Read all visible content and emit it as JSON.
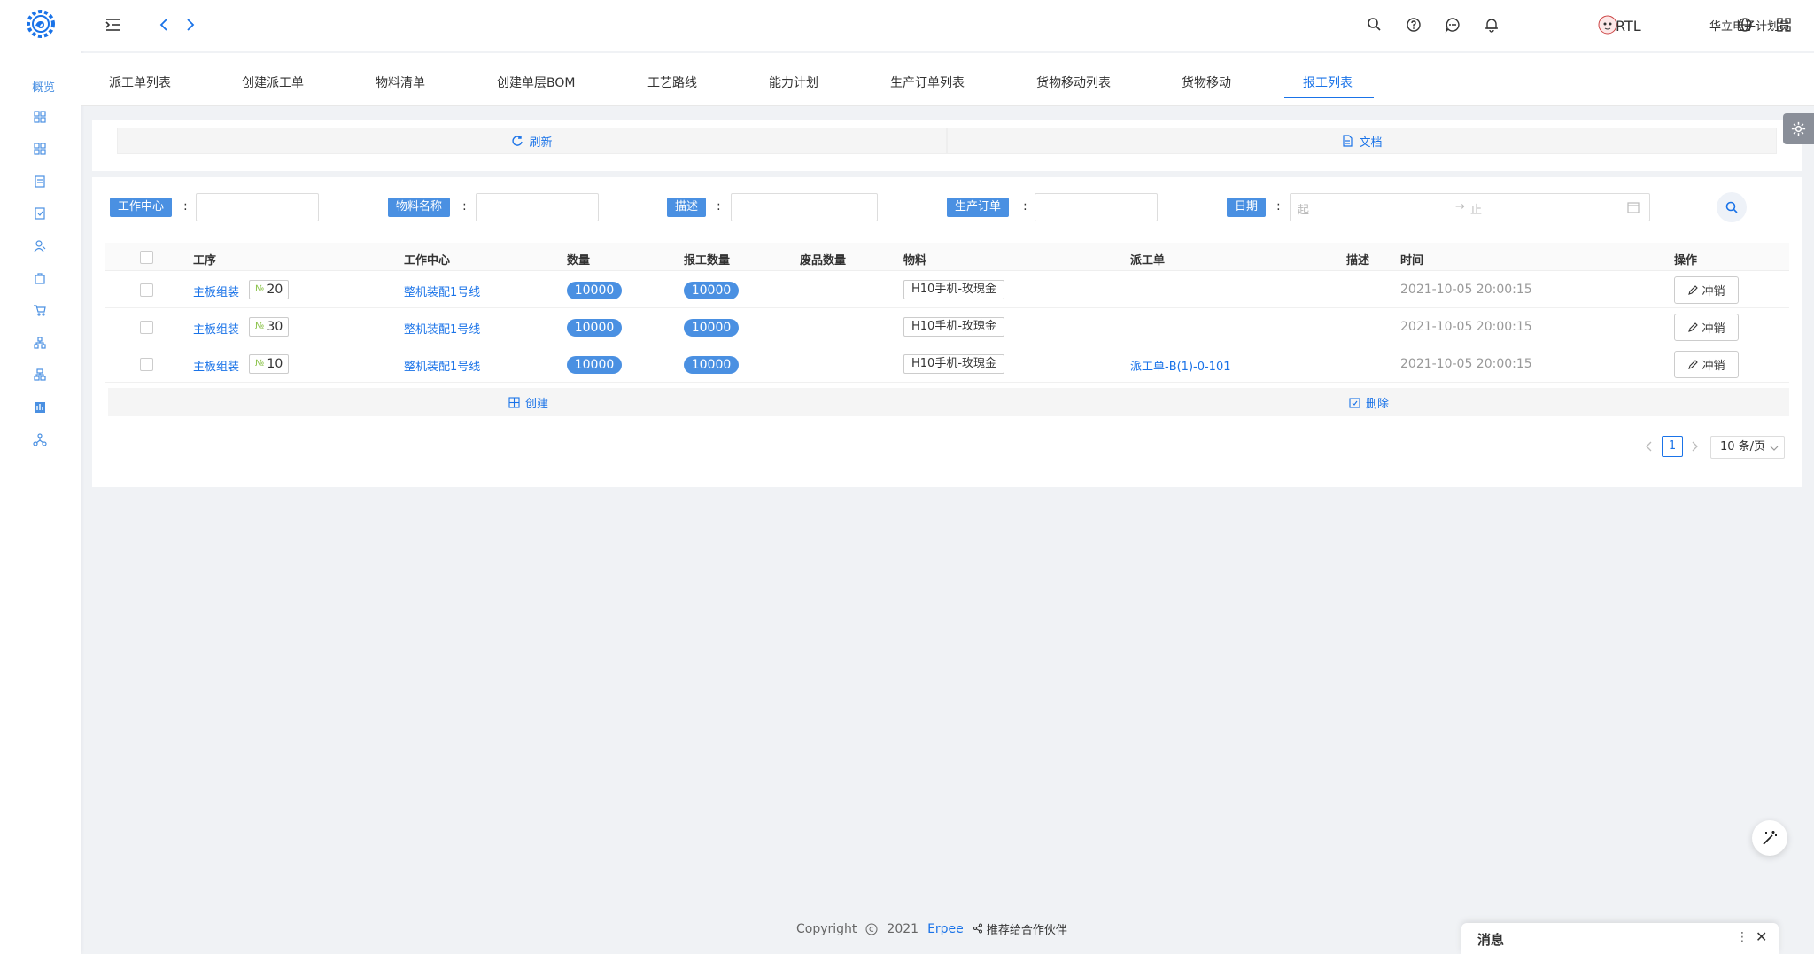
{
  "sidebar": {
    "label": "概览",
    "icons": [
      "grid-icon",
      "apps-icon",
      "document-icon",
      "shield-doc-icon",
      "users-icon",
      "bag-icon",
      "cart-icon",
      "org-chart-icon",
      "hierarchy-icon",
      "report-icon",
      "network-icon"
    ]
  },
  "header": {
    "rtl_label": "RTL",
    "user_name": "华立电子计划员"
  },
  "tabs": [
    {
      "label": "派工单列表"
    },
    {
      "label": "创建派工单"
    },
    {
      "label": "物料清单"
    },
    {
      "label": "创建单层BOM"
    },
    {
      "label": "工艺路线"
    },
    {
      "label": "能力计划"
    },
    {
      "label": "生产订单列表"
    },
    {
      "label": "货物移动列表"
    },
    {
      "label": "货物移动"
    },
    {
      "label": "报工列表",
      "active": true
    }
  ],
  "toolbar": {
    "refresh_label": "刷新",
    "docs_label": "文档"
  },
  "filters": {
    "work_center": "工作中心",
    "material_name": "物料名称",
    "description": "描述",
    "production_order": "生产订单",
    "date": "日期",
    "date_start_placeholder": "起",
    "date_end_placeholder": "止",
    "colon": ":"
  },
  "table": {
    "columns": [
      "工序",
      "工作中心",
      "数量",
      "报工数量",
      "废品数量",
      "物料",
      "派工单",
      "描述",
      "时间",
      "操作"
    ],
    "rows": [
      {
        "operation": "主板组装",
        "no": "20",
        "work_center": "整机装配1号线",
        "qty": "10000",
        "reported_qty": "10000",
        "scrap_qty": "",
        "material": "H10手机-玫瑰金",
        "dispatch": "",
        "desc": "",
        "time": "2021-10-05 20:00:15",
        "action": "冲销"
      },
      {
        "operation": "主板组装",
        "no": "30",
        "work_center": "整机装配1号线",
        "qty": "10000",
        "reported_qty": "10000",
        "scrap_qty": "",
        "material": "H10手机-玫瑰金",
        "dispatch": "",
        "desc": "",
        "time": "2021-10-05 20:00:15",
        "action": "冲销"
      },
      {
        "operation": "主板组装",
        "no": "10",
        "work_center": "整机装配1号线",
        "qty": "10000",
        "reported_qty": "10000",
        "scrap_qty": "",
        "material": "H10手机-玫瑰金",
        "dispatch": "派工单-B(1)-0-101",
        "desc": "",
        "time": "2021-10-05 20:00:15",
        "action": "冲销"
      }
    ],
    "no_symbol": "№",
    "create_label": "创建",
    "delete_label": "删除"
  },
  "pagination": {
    "current_page": "1",
    "page_size": "10 条/页"
  },
  "footer": {
    "copyright": "Copyright",
    "year": "2021",
    "brand": "Erpee",
    "share_label": "推荐给合作伙伴"
  },
  "messages": {
    "title": "消息"
  },
  "colors": {
    "primary": "#1a73e8",
    "label_blue": "#4a90e2"
  }
}
